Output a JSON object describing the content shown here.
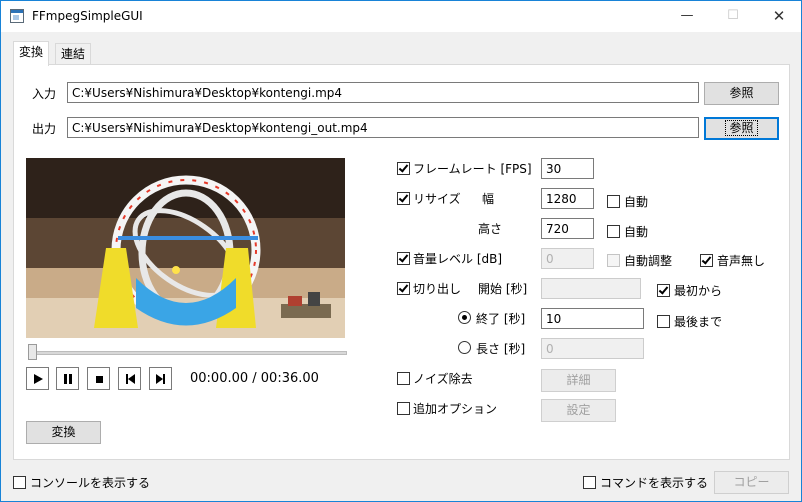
{
  "window": {
    "title": "FFmpegSimpleGUI",
    "controls": {
      "minimize": "—",
      "maximize": "☐",
      "close": "✕"
    }
  },
  "tabs": [
    {
      "label": "変換",
      "active": true
    },
    {
      "label": "連結",
      "active": false
    }
  ],
  "io": {
    "input_label": "入力",
    "input_value": "C:¥Users¥Nishimura¥Desktop¥kontengi.mp4",
    "input_browse": "参照",
    "output_label": "出力",
    "output_value": "C:¥Users¥Nishimura¥Desktop¥kontengi_out.mp4",
    "output_browse": "参照"
  },
  "player": {
    "time": "00:00.00 / 00:36.00",
    "progress": 0.0,
    "buttons": [
      "play-icon",
      "pause-icon",
      "stop-icon",
      "skip-back-icon",
      "skip-forward-icon"
    ]
  },
  "convert_button": "変換",
  "options": {
    "framerate": {
      "label": "フレームレート [FPS]",
      "checked": true,
      "value": "30"
    },
    "resize": {
      "label": "リサイズ",
      "checked": true,
      "width_label": "幅",
      "width_value": "1280",
      "width_auto_label": "自動",
      "width_auto": false,
      "height_label": "高さ",
      "height_value": "720",
      "height_auto_label": "自動",
      "height_auto": false
    },
    "volume": {
      "label": "音量レベル [dB]",
      "checked": true,
      "value": "0",
      "auto_label": "自動調整",
      "auto": false,
      "mute_label": "音声無し",
      "mute": true
    },
    "trim": {
      "label": "切り出し",
      "checked": true,
      "start_label": "開始 [秒]",
      "start_value": "",
      "from_start_label": "最初から",
      "from_start": true,
      "end_label": "終了 [秒]",
      "end_value": "10",
      "end_selected": true,
      "to_end_label": "最後まで",
      "to_end": false,
      "length_label": "長さ [秒]",
      "length_value": "0",
      "length_selected": false
    },
    "denoise": {
      "label": "ノイズ除去",
      "checked": false,
      "button": "詳細"
    },
    "extra": {
      "label": "追加オプション",
      "checked": false,
      "button": "設定"
    }
  },
  "footer": {
    "show_console_label": "コンソールを表示する",
    "show_console": false,
    "show_command_label": "コマンドを表示する",
    "show_command": false,
    "copy_button": "コピー"
  },
  "colors": {
    "accent": "#0078d7",
    "window_border": "#1883d7",
    "panel_bg": "#ffffff",
    "window_bg": "#f0f0f0"
  }
}
